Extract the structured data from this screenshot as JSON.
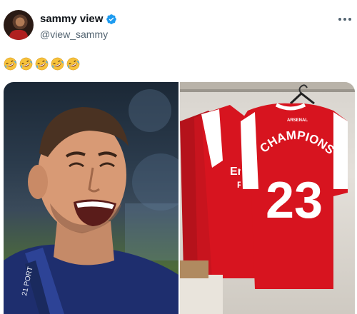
{
  "tweet": {
    "author": {
      "display_name": "sammy view",
      "handle": "@view_sammy",
      "verified": true,
      "avatar_icon": "avatar-photo"
    },
    "text_emojis": [
      "rolling-on-floor-laughing-icon",
      "rolling-on-floor-laughing-icon",
      "rolling-on-floor-laughing-icon",
      "rolling-on-floor-laughing-icon",
      "rolling-on-floor-laughing-icon"
    ],
    "more_icon": "more-horizontal-icon",
    "media": {
      "count": 2,
      "left_image": "smiling-footballer-photo",
      "right_image": "arsenal-shirts-photo",
      "jersey_club_text": "ARSENAL",
      "jersey_name": "CHAMPIONS",
      "jersey_number": "23",
      "jersey_sponsor_partial": "Em",
      "jersey_sponsor_partial_2": "F",
      "scarf_text": "21 PORT"
    },
    "colors": {
      "verified_blue": "#1d9bf0",
      "handle_gray": "#536471",
      "arsenal_red": "#d7141f"
    }
  }
}
